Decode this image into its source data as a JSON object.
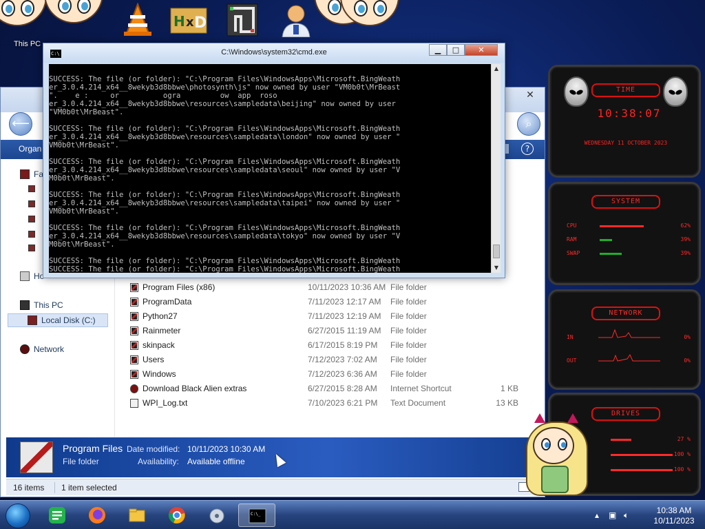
{
  "desktop": {
    "this_pc_label": "This PC"
  },
  "cmd": {
    "title": "C:\\Windows\\system32\\cmd.exe",
    "lines": [
      "",
      "SUCCESS: The file (or folder): \"C:\\Program Files\\WindowsApps\\Microsoft.BingWeath",
      "er_3.0.4.214_x64__8wekyb3d8bbwe\\photosynth\\js\" now owned by user \"VM0b0t\\MrBeast",
      "\".    e :     or          ogra         ow  app  roso",
      "er_3.0.4.214_x64__8wekyb3d8bbwe\\resources\\sampledata\\beijing\" now owned by user",
      "\"VM0b0t\\MrBeast\".",
      "",
      "SUCCESS: The file (or folder): \"C:\\Program Files\\WindowsApps\\Microsoft.BingWeath",
      "er_3.0.4.214_x64__8wekyb3d8bbwe\\resources\\sampledata\\london\" now owned by user \"",
      "VM0b0t\\MrBeast\".",
      "",
      "SUCCESS: The file (or folder): \"C:\\Program Files\\WindowsApps\\Microsoft.BingWeath",
      "er_3.0.4.214_x64__8wekyb3d8bbwe\\resources\\sampledata\\seoul\" now owned by user \"V",
      "M0b0t\\MrBeast\".",
      "",
      "SUCCESS: The file (or folder): \"C:\\Program Files\\WindowsApps\\Microsoft.BingWeath",
      "er_3.0.4.214_x64__8wekyb3d8bbwe\\resources\\sampledata\\taipei\" now owned by user \"",
      "VM0b0t\\MrBeast\".",
      "",
      "SUCCESS: The file (or folder): \"C:\\Program Files\\WindowsApps\\Microsoft.BingWeath",
      "er_3.0.4.214_x64__8wekyb3d8bbwe\\resources\\sampledata\\tokyo\" now owned by user \"V",
      "M0b0t\\MrBeast\".",
      "",
      "SUCCESS: The file (or folder): \"C:\\Program Files\\WindowsApps\\Microsoft.BingWeath",
      "SUCCESS: The file (or folder): \"C:\\Program Files\\WindowsApps\\Microsoft.BingWeath"
    ]
  },
  "explorer": {
    "organize_label": "Organ",
    "nav": {
      "favorites": "Fa",
      "homegroup": "Ho",
      "this_pc": "This PC",
      "local_disk": "Local Disk (C:)",
      "network": "Network"
    },
    "files": [
      {
        "name": "Program Files (x86)",
        "date": "10/11/2023 10:36 AM",
        "type": "File folder",
        "size": "",
        "icon": "folder"
      },
      {
        "name": "ProgramData",
        "date": "7/11/2023 12:17 AM",
        "type": "File folder",
        "size": "",
        "icon": "folder"
      },
      {
        "name": "Python27",
        "date": "7/11/2023 12:19 AM",
        "type": "File folder",
        "size": "",
        "icon": "folder"
      },
      {
        "name": "Rainmeter",
        "date": "6/27/2015 11:19 AM",
        "type": "File folder",
        "size": "",
        "icon": "folder"
      },
      {
        "name": "skinpack",
        "date": "6/17/2015 8:19 PM",
        "type": "File folder",
        "size": "",
        "icon": "folder"
      },
      {
        "name": "Users",
        "date": "7/12/2023 7:02 AM",
        "type": "File folder",
        "size": "",
        "icon": "folder"
      },
      {
        "name": "Windows",
        "date": "7/12/2023 6:36 AM",
        "type": "File folder",
        "size": "",
        "icon": "folder"
      },
      {
        "name": "Download Black Alien extras",
        "date": "6/27/2015 8:28 AM",
        "type": "Internet Shortcut",
        "size": "1 KB",
        "icon": "shortcut"
      },
      {
        "name": "WPI_Log.txt",
        "date": "7/10/2023 6:21 PM",
        "type": "Text Document",
        "size": "13 KB",
        "icon": "txt"
      }
    ],
    "details": {
      "name": "Program Files",
      "type": "File folder",
      "date_label": "Date modified:",
      "date_value": "10/11/2023 10:30 AM",
      "avail_label": "Availability:",
      "avail_value": "Available offline"
    },
    "status": {
      "count": "16 items",
      "selected": "1 item selected"
    }
  },
  "widgets": {
    "time": {
      "title": "TIME",
      "clock": "10:38:07",
      "date": "WEDNESDAY 11 OCTOBER 2023"
    },
    "system": {
      "title": "SYSTEM",
      "rows": [
        {
          "label": "CPU",
          "percent": "62%",
          "level": 0.62,
          "color": "red"
        },
        {
          "label": "RAM",
          "percent": "39%",
          "level": 0.18,
          "color": "green"
        },
        {
          "label": "SWAP",
          "percent": "39%",
          "level": 0.3,
          "color": "green"
        }
      ]
    },
    "network": {
      "title": "NETWORK",
      "rows": [
        {
          "label": "IN",
          "value": "0%"
        },
        {
          "label": "OUT",
          "value": "0%"
        }
      ]
    },
    "drives": {
      "title": "DRIVES",
      "rows": [
        {
          "value": "27 %"
        },
        {
          "value": "100 %"
        },
        {
          "value": "100 %"
        }
      ]
    }
  },
  "taskbar": {
    "time": "10:38 AM",
    "date": "10/11/2023"
  },
  "colors": {
    "widget_red": "#ff2a2a",
    "explorer_blue": "#1d4590",
    "cmd_text": "#c0c0c0"
  }
}
